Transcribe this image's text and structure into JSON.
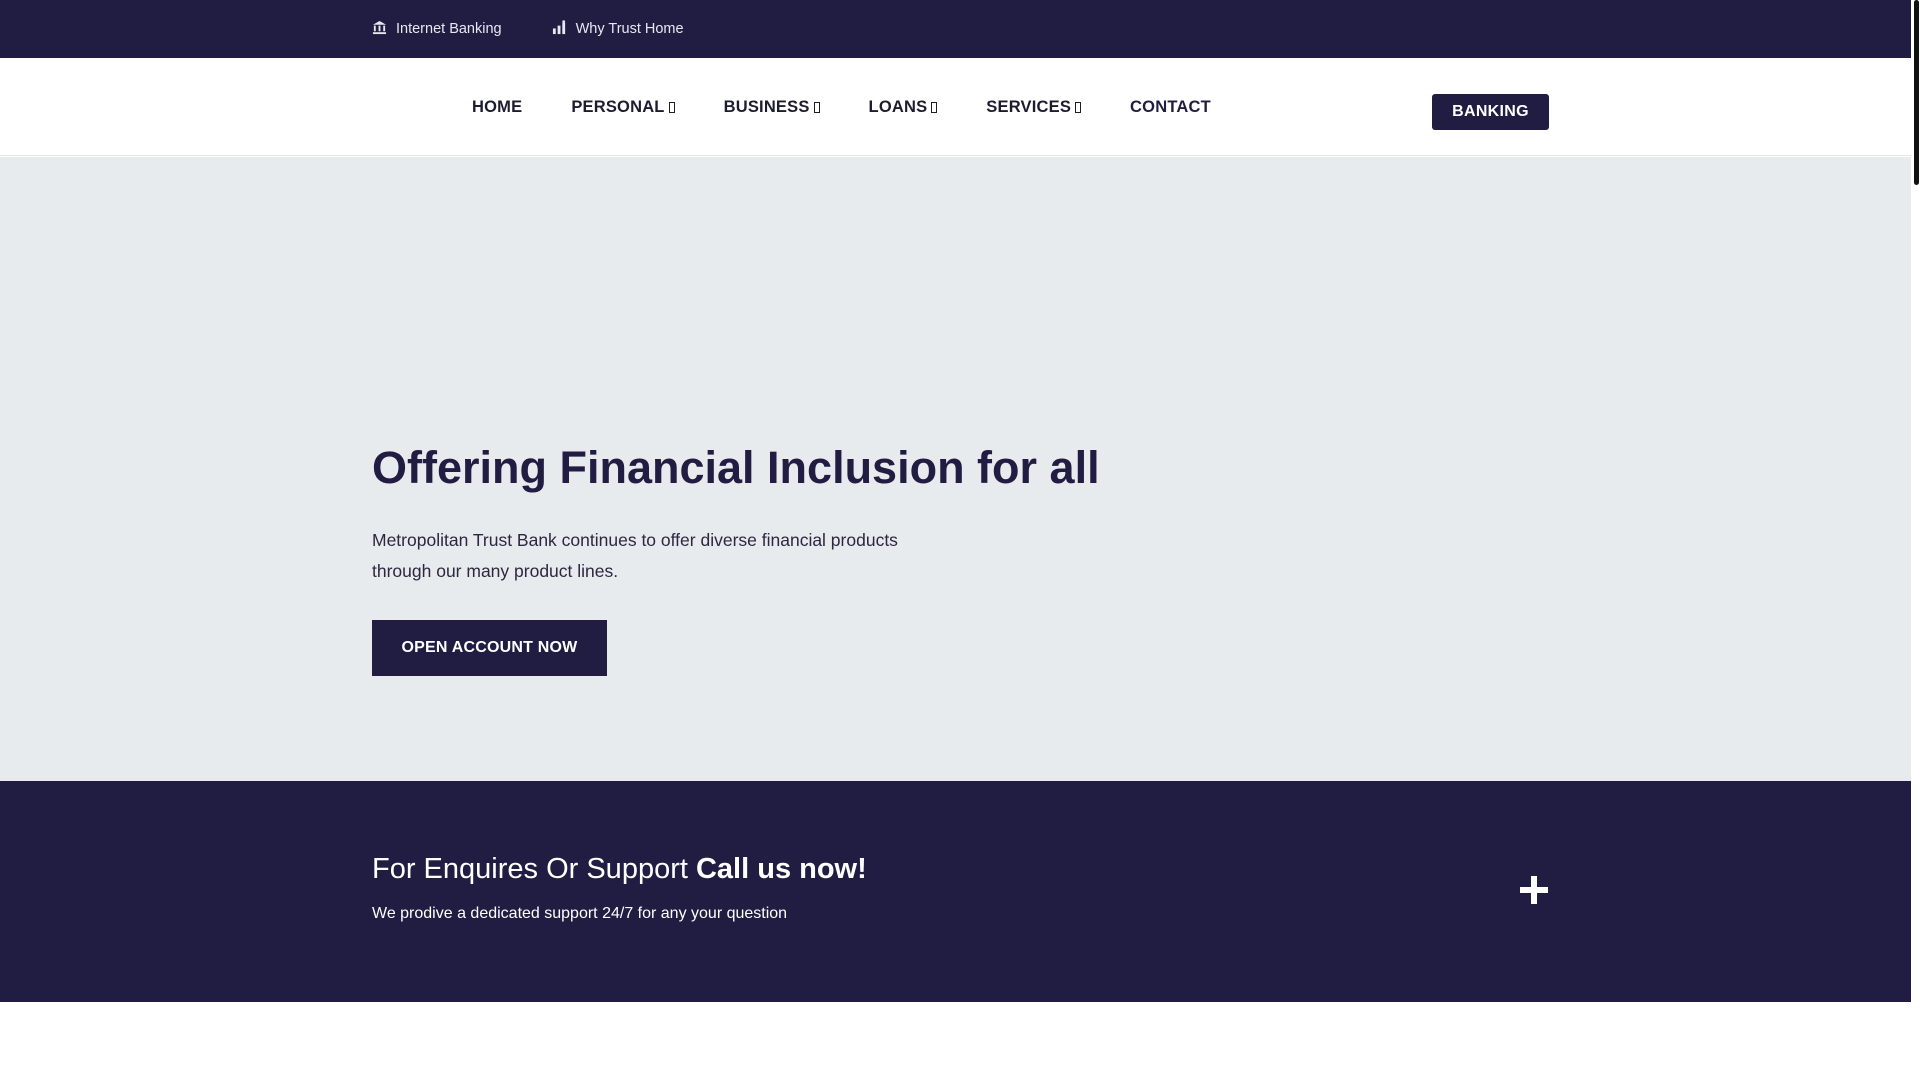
{
  "topbar": {
    "links": [
      {
        "label": "Internet Banking",
        "icon": "bank-icon"
      },
      {
        "label": "Why Trust Home",
        "icon": "chart-icon"
      }
    ]
  },
  "nav": {
    "items": [
      {
        "label": "HOME",
        "has_caret": false
      },
      {
        "label": "PERSONAL",
        "has_caret": true
      },
      {
        "label": "BUSINESS",
        "has_caret": true
      },
      {
        "label": "LOANS",
        "has_caret": true
      },
      {
        "label": "SERVICES",
        "has_caret": true
      },
      {
        "label": "CONTACT",
        "has_caret": false
      }
    ],
    "banking_label": "BANKING"
  },
  "hero": {
    "title": "Offering Financial Inclusion for all",
    "description": "Metropolitan Trust Bank continues to offer diverse financial products through our many product lines.",
    "cta_label": "OPEN ACCOUNT NOW"
  },
  "support": {
    "title_normal": "For Enquires Or Support ",
    "title_bold": "Call us now!",
    "subtitle": "We prodive a dedicated support 24/7 for any your question"
  },
  "colors": {
    "primary": "#201c42",
    "hero_bg": "#e7ebee"
  }
}
